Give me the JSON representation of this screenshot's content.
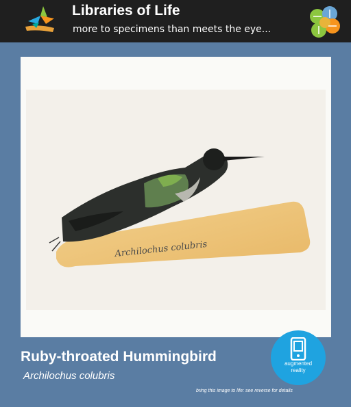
{
  "header": {
    "title": "Libraries of Life",
    "tagline": "more to specimens than meets the eye...",
    "left_logo_icon": "leaf-logo-icon",
    "right_logo_icon": "leaf-circles-logo-icon"
  },
  "photo": {
    "subject": "hummingbird-specimen",
    "label_text": "Archilochus colubris"
  },
  "species": {
    "common_name": "Ruby-throated Hummingbird",
    "scientific_name": "Archilochus colubris"
  },
  "ar_badge": {
    "icon": "phone-icon",
    "line1": "augmented",
    "line2": "reality"
  },
  "footer": {
    "note": "bring this image to life: see reverse for details"
  },
  "colors": {
    "background": "#5a7da3",
    "header": "#1f1f1f",
    "badge": "#1fa3e0"
  }
}
